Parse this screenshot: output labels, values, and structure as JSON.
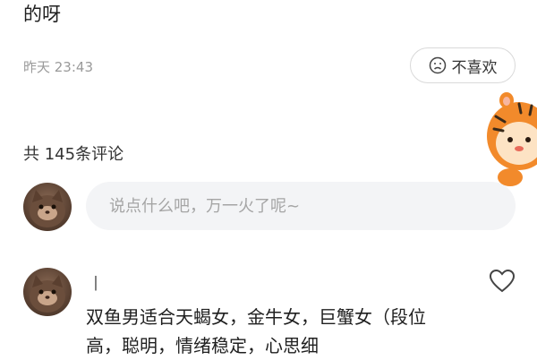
{
  "post": {
    "text_tail": "的呀",
    "timestamp": "昨天 23:43",
    "dislike_label": "不喜欢"
  },
  "comments_section": {
    "count_label": "共 145条评论",
    "input_placeholder": "说点什么吧，万一火了呢~"
  },
  "comments": [
    {
      "username": "丨",
      "text": "双鱼男适合天蝎女，金牛女，巨蟹女（段位高，聪明，情绪稳定，心思细"
    }
  ],
  "icons": {
    "dislike": "frown-face-icon",
    "like": "heart-outline-icon",
    "mascot": "tiger-mascot-icon",
    "avatar": "cat-avatar-icon"
  }
}
